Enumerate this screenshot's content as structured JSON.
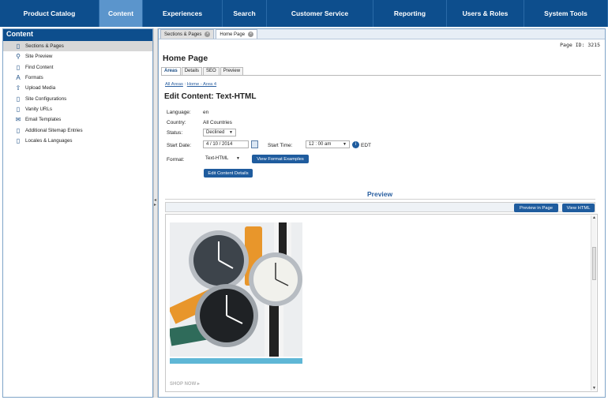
{
  "nav": {
    "items": [
      "Product Catalog",
      "Content",
      "Experiences",
      "Search",
      "Customer Service",
      "Reporting",
      "Users & Roles",
      "System Tools"
    ],
    "active": "Content"
  },
  "sidebar": {
    "title": "Content",
    "items": [
      {
        "label": "Sections & Pages",
        "icon": "document-icon"
      },
      {
        "label": "Site Preview",
        "icon": "magnifier-icon"
      },
      {
        "label": "Find Content",
        "icon": "find-document-icon"
      },
      {
        "label": "Formats",
        "icon": "formats-icon"
      },
      {
        "label": "Upload Media",
        "icon": "upload-icon"
      },
      {
        "label": "Site Configurations",
        "icon": "document-icon"
      },
      {
        "label": "Vanity URLs",
        "icon": "document-icon"
      },
      {
        "label": "Email Templates",
        "icon": "envelope-icon"
      },
      {
        "label": "Additional Sitemap Entries",
        "icon": "document-icon"
      },
      {
        "label": "Locales & Languages",
        "icon": "document-icon"
      }
    ]
  },
  "file_tabs": [
    {
      "label": "Sections & Pages"
    },
    {
      "label": "Home Page"
    }
  ],
  "page": {
    "id_text": "Page ID: 3215",
    "title": "Home Page",
    "subtabs": [
      "Areas",
      "Details",
      "SEO",
      "Preview"
    ],
    "breadcrumb": {
      "link1": "All Areas",
      "sep": " : ",
      "link2": "Home - Area 4"
    }
  },
  "edit": {
    "title": "Edit Content: Text-HTML",
    "language_label": "Language:",
    "language_value": "en",
    "country_label": "Country:",
    "country_value": "All Countries",
    "status_label": "Status:",
    "status_value": "Declined",
    "start_date_label": "Start Date:",
    "start_date_value": "4  /  10  /  2014",
    "start_time_label": "Start Time:",
    "start_time_value": "12 : 00   am",
    "timezone": "EDT",
    "format_label": "Format:",
    "format_value": "Text-HTML",
    "view_format_button": "View Format Examples",
    "edit_details_button": "Edit Content Details"
  },
  "preview": {
    "heading": "Preview",
    "preview_in_page_button": "Preview in Page",
    "view_html_button": "View HTML",
    "shop_now": "SHOP NOW ▸"
  }
}
